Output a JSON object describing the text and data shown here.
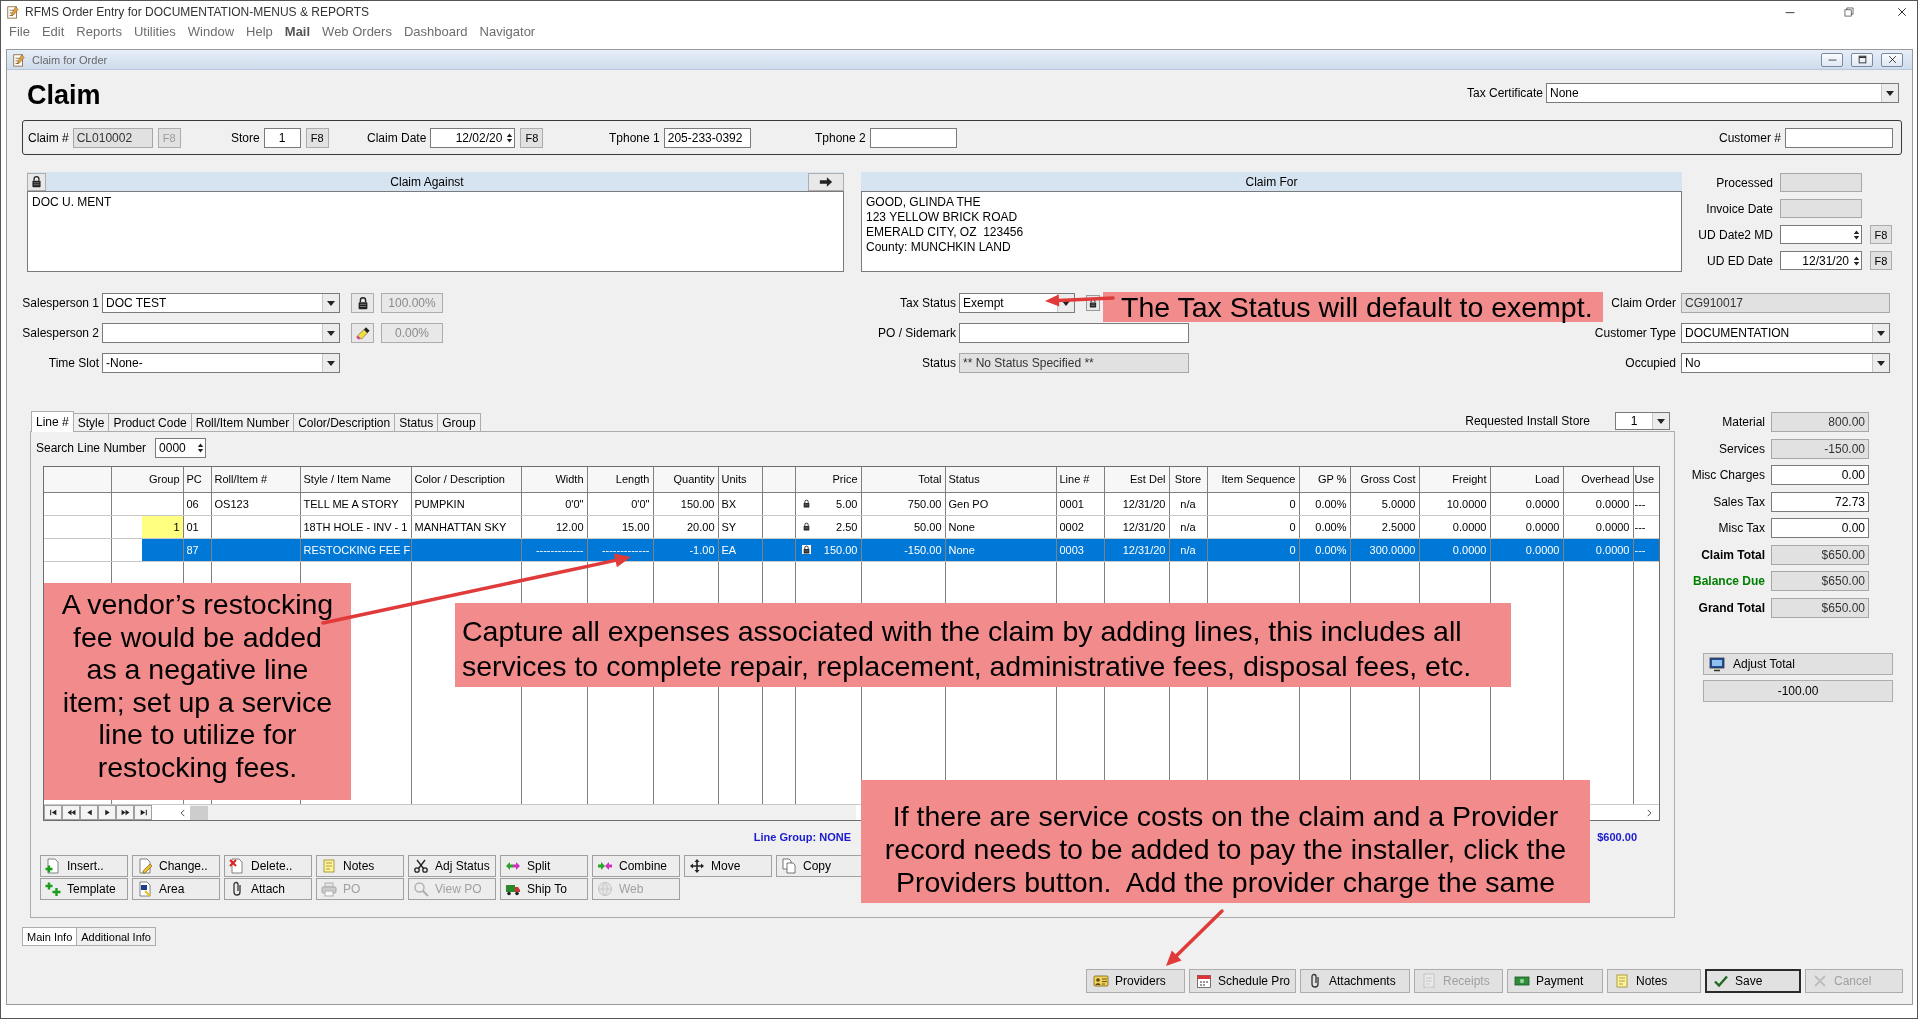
{
  "app": {
    "title": "RFMS Order Entry for DOCUMENTATION-MENUS & REPORTS"
  },
  "menu": [
    {
      "label": "File",
      "bold": false
    },
    {
      "label": "Edit",
      "bold": false
    },
    {
      "label": "Reports",
      "bold": false
    },
    {
      "label": "Utilities",
      "bold": false
    },
    {
      "label": "Window",
      "bold": false
    },
    {
      "label": "Help",
      "bold": false
    },
    {
      "label": "Mail",
      "bold": true
    },
    {
      "label": "Web Orders",
      "bold": false
    },
    {
      "label": "Dashboard",
      "bold": false
    },
    {
      "label": "Navigator",
      "bold": false
    }
  ],
  "window": {
    "title": "Claim for Order",
    "heading": "Claim"
  },
  "tax_certificate": {
    "label": "Tax Certificate",
    "value": "None"
  },
  "header_fields": [
    {
      "label": "Claim #",
      "kind": "text",
      "value": "CL010002",
      "readonly": true,
      "button": {
        "label": "F8",
        "disabled": true
      }
    },
    {
      "label": "Store",
      "kind": "text",
      "value": "1",
      "readonly": false,
      "button": {
        "label": "F8",
        "disabled": false
      }
    },
    {
      "label": "Claim Date",
      "kind": "spin",
      "value": "12/02/20",
      "readonly": false,
      "button": {
        "label": "F8",
        "disabled": false
      }
    },
    {
      "label": "Tphone 1",
      "kind": "text",
      "value": "205-233-0392",
      "readonly": false
    },
    {
      "label": "Tphone 2",
      "kind": "text",
      "readonly": false
    },
    {
      "label": "Customer #",
      "kind": "text",
      "readonly": false
    }
  ],
  "claim_against": {
    "title": "Claim Against",
    "text": "DOC U. MENT"
  },
  "claim_for": {
    "title": "Claim For",
    "text": "GOOD, GLINDA THE\n123 YELLOW BRICK ROAD\nEMERALD CITY, OZ  123456\nCounty: MUNCHKIN LAND"
  },
  "dates": [
    {
      "label": "Processed",
      "kind": "text",
      "readonly": true
    },
    {
      "label": "Invoice Date",
      "kind": "text",
      "readonly": true
    },
    {
      "label": "UD Date2 MD",
      "kind": "spin",
      "readonly": false,
      "button": {
        "label": "F8",
        "disabled": false
      }
    },
    {
      "label": "UD ED Date",
      "kind": "spin",
      "value": "12/31/20",
      "readonly": false,
      "button": {
        "label": "F8",
        "disabled": false
      }
    }
  ],
  "salespeople": [
    {
      "label": "Salesperson 1",
      "value": "DOC TEST",
      "percent": "100.00%"
    },
    {
      "label": "Salesperson 2",
      "percent": "0.00%"
    },
    {
      "label": "Time Slot",
      "value": "-None-"
    }
  ],
  "order_fields": [
    {
      "label": "Tax Status",
      "kind": "select",
      "value": "Exempt",
      "readonly": false
    },
    {
      "label": "PO / Sidemark",
      "kind": "text",
      "readonly": false
    },
    {
      "label": "Status",
      "kind": "text",
      "value": "** No Status Specified **",
      "readonly": true
    }
  ],
  "customer_fields": [
    {
      "label": "Claim Order",
      "kind": "text",
      "value": "CG910017",
      "readonly": true
    },
    {
      "label": "Customer Type",
      "kind": "select",
      "value": "DOCUMENTATION",
      "readonly": false
    },
    {
      "label": "Occupied",
      "kind": "select",
      "value": "No",
      "readonly": false
    }
  ],
  "line_tabs": [
    {
      "label": "Line #",
      "selected": true
    },
    {
      "label": "Style",
      "selected": false
    },
    {
      "label": "Product Code",
      "selected": false
    },
    {
      "label": "Roll/Item Number",
      "selected": false
    },
    {
      "label": "Color/Description",
      "selected": false
    },
    {
      "label": "Status",
      "selected": false
    },
    {
      "label": "Group",
      "selected": false
    }
  ],
  "install_store": {
    "label": "Requested Install Store",
    "value": "1"
  },
  "search_line": {
    "label": "Search Line Number",
    "value": "0000"
  },
  "table": {
    "columns": [
      null,
      "Group",
      "PC",
      "Roll/Item #",
      "Style / Item Name",
      "Color / Description",
      "Width",
      "Length",
      "Quantity",
      "Units",
      null,
      "Price",
      "Total",
      "Status",
      "Line #",
      "Est Del",
      "Store",
      "Item Sequence",
      "GP %",
      "Gross Cost",
      "Freight",
      "Load",
      "Overhead",
      "Use"
    ],
    "rows": [
      {
        "selected": false,
        "group_highlighted": false,
        "price_locked": true,
        "cells": [
          null,
          null,
          "06",
          "OS123",
          "TELL ME A STORY",
          "PUMPKIN",
          "0'0\"",
          "0'0\"",
          "150.00",
          "BX",
          null,
          "5.00",
          "750.00",
          "Gen PO",
          "0001",
          "12/31/20",
          "n/a",
          "0",
          "0.00%",
          "5.0000",
          "10.0000",
          "0.0000",
          "0.0000",
          "---"
        ]
      },
      {
        "selected": false,
        "group_highlighted": true,
        "price_locked": true,
        "cells": [
          null,
          "1",
          "01",
          null,
          "18TH HOLE - INV - 1",
          "MANHATTAN SKY",
          "12.00",
          "15.00",
          "20.00",
          "SY",
          null,
          "2.50",
          "50.00",
          "None",
          "0002",
          "12/31/20",
          "n/a",
          "0",
          "0.00%",
          "2.5000",
          "0.0000",
          "0.0000",
          "0.0000",
          "---"
        ]
      },
      {
        "selected": true,
        "group_highlighted": false,
        "price_locked": true,
        "cells": [
          null,
          null,
          "87",
          null,
          "RESTOCKING FEE F",
          null,
          "-------------",
          "-------------",
          "-1.00",
          "EA",
          null,
          "150.00",
          "-150.00",
          "None",
          "0003",
          "12/31/20",
          "n/a",
          "0",
          "0.00%",
          "300.0000",
          "0.0000",
          "0.0000",
          "0.0000",
          "---"
        ]
      }
    ],
    "line_group": "Line Group: NONE",
    "total": "$600.00"
  },
  "line_buttons": [
    [
      {
        "label": "Insert..",
        "disabled": false
      },
      {
        "label": "Change..",
        "disabled": false
      },
      {
        "label": "Delete..",
        "disabled": false
      },
      {
        "label": "Notes",
        "disabled": false
      },
      {
        "label": "Adj Status",
        "disabled": false
      },
      {
        "label": "Split",
        "disabled": false
      },
      {
        "label": "Combine",
        "disabled": false
      },
      {
        "label": "Move",
        "disabled": false
      },
      {
        "label": "Copy",
        "disabled": false
      }
    ],
    [
      {
        "label": "Template",
        "disabled": false
      },
      {
        "label": "Area",
        "disabled": false
      },
      {
        "label": "Attach",
        "disabled": false
      },
      {
        "label": "PO",
        "disabled": true
      },
      {
        "label": "View PO",
        "disabled": true
      },
      {
        "label": "Ship To",
        "disabled": false
      },
      {
        "label": "Web",
        "disabled": true
      }
    ]
  ],
  "totals": [
    {
      "label": "Material",
      "value": "800.00",
      "readonly": true,
      "bold": false,
      "color": "#000000"
    },
    {
      "label": "Services",
      "value": "-150.00",
      "readonly": true,
      "bold": false,
      "color": "#000000"
    },
    {
      "label": "Misc Charges",
      "value": "0.00",
      "readonly": false,
      "bold": false,
      "color": "#000000"
    },
    {
      "label": "Sales Tax",
      "value": "72.73",
      "readonly": false,
      "bold": false,
      "color": "#000000"
    },
    {
      "label": "Misc Tax",
      "value": "0.00",
      "readonly": false,
      "bold": false,
      "color": "#000000"
    },
    {
      "label": "Claim Total",
      "value": "$650.00",
      "readonly": true,
      "bold": true,
      "color": "#000000"
    },
    {
      "label": "Balance Due",
      "value": "$650.00",
      "readonly": true,
      "bold": true,
      "color": "#008000"
    },
    {
      "label": "Grand Total",
      "value": "$650.00",
      "readonly": true,
      "bold": true,
      "color": "#000000"
    }
  ],
  "adjust_total": {
    "label": "Adjust Total",
    "value": "-100.00"
  },
  "bottom_tabs": [
    {
      "label": "Main Info",
      "selected": true
    },
    {
      "label": "Additional Info",
      "selected": false
    }
  ],
  "actions": [
    {
      "label": "Providers",
      "disabled": false,
      "default": false
    },
    {
      "label": "Schedule Pro",
      "disabled": false,
      "default": false
    },
    {
      "label": "Attachments",
      "disabled": false,
      "default": false
    },
    {
      "label": "Receipts",
      "disabled": true,
      "default": false
    },
    {
      "label": "Payment",
      "disabled": false,
      "default": false
    },
    {
      "label": "Notes",
      "disabled": false,
      "default": false
    },
    {
      "label": "Save",
      "disabled": false,
      "default": true
    },
    {
      "label": "Cancel",
      "disabled": true,
      "default": false
    }
  ],
  "annotations": [
    {
      "text": "The Tax Status will default to exempt."
    },
    {
      "text": "A vendor’s restocking\nfee would be added\nas a negative line\nitem; set up a service\nline to utilize for\nrestocking fees."
    },
    {
      "text": "Capture all expenses associated with the claim by adding lines, this includes all\nservices to complete repair, replacement, administrative fees, disposal fees, etc."
    },
    {
      "text": "If there are service costs on the claim and a Provider\nrecord needs to be added to pay the installer, click the\nProviders button.  Add the provider charge the same"
    }
  ]
}
